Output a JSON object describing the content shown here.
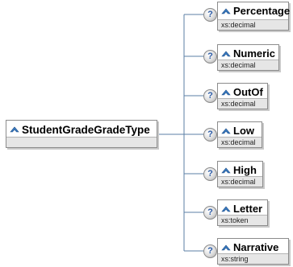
{
  "root": {
    "name": "StudentGradeGradeType"
  },
  "children": [
    {
      "name": "Percentage",
      "type": "xs:decimal"
    },
    {
      "name": "Numeric",
      "type": "xs:decimal"
    },
    {
      "name": "OutOf",
      "type": "xs:decimal"
    },
    {
      "name": "Low",
      "type": "xs:decimal"
    },
    {
      "name": "High",
      "type": "xs:decimal"
    },
    {
      "name": "Letter",
      "type": "xs:token"
    },
    {
      "name": "Narrative",
      "type": "xs:string"
    }
  ],
  "info_glyph": "?",
  "icons": {
    "element": "element-icon",
    "info": "question-icon"
  },
  "colors": {
    "icon_blue": "#3a7ec8",
    "border": "#8c8c8c",
    "subbar": "#e6e6e6",
    "connector": "#5b7fa6"
  }
}
